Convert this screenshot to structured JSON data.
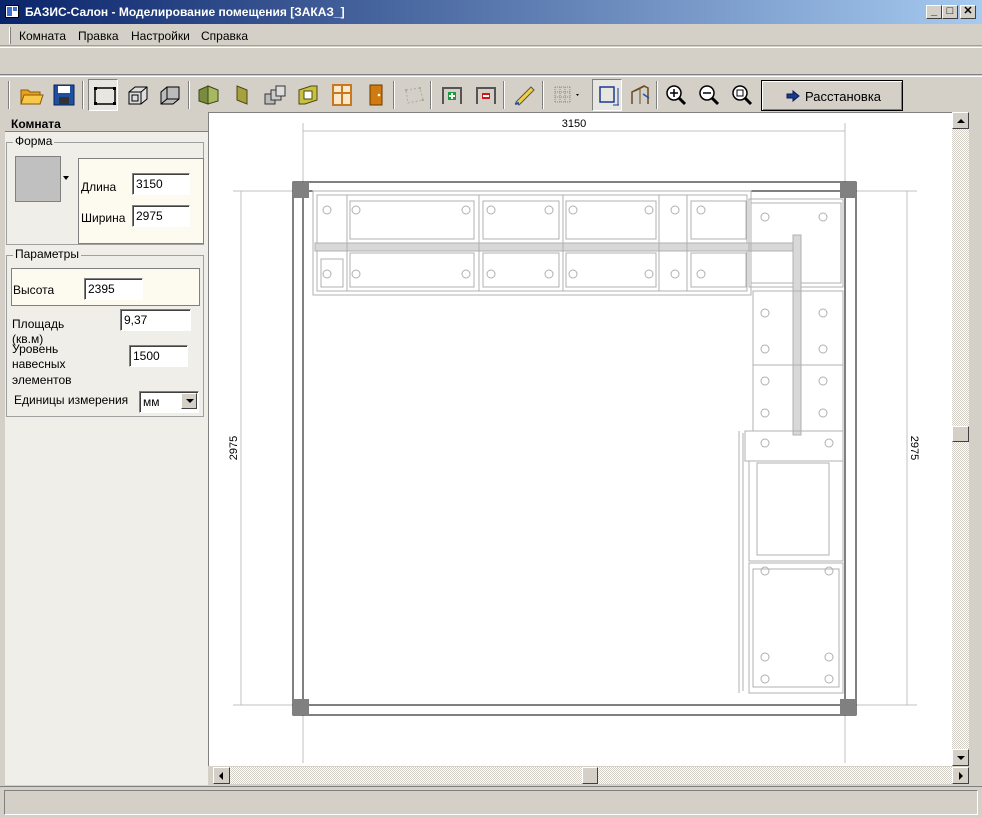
{
  "window": {
    "title": "БАЗИС-Салон - Моделирование помещения [ЗАКАЗ_]",
    "minimize_glyph": "_",
    "maximize_glyph": "□",
    "close_glyph": "✕"
  },
  "menu": {
    "items": [
      "Комната",
      "Правка",
      "Настройки",
      "Справка"
    ]
  },
  "toolbar": {
    "icons": [
      "open-folder-icon",
      "save-disk-icon",
      "room-outline-icon",
      "box-3d-icon",
      "box-3d-alt-icon",
      "wall-panels-icon",
      "wall-panel-icon",
      "cylinder-blocks-icon",
      "wall-niche-icon",
      "window-frame-icon",
      "door-icon",
      "polygon-room-icon",
      "add-wall-icon",
      "remove-wall-icon",
      "measure-icon",
      "grid-icon",
      "room-select-icon",
      "stairs-icon",
      "zoom-in-icon",
      "zoom-out-icon",
      "zoom-fit-icon"
    ],
    "arrange_label": "Расстановка"
  },
  "panel": {
    "header": "Комната",
    "shape_group": "Форма",
    "length_label": "Длина",
    "length_value": "3150",
    "width_label": "Ширина",
    "width_value": "2975",
    "params_group": "Параметры",
    "height_label": "Высота",
    "height_value": "2395",
    "area_label_1": "Площадь",
    "area_label_2": "(кв.м)",
    "area_value": "9,37",
    "level_label_1": "Уровень",
    "level_label_2": "навесных",
    "level_label_3": "элементов",
    "level_value": "1500",
    "units_label": "Единицы измерения",
    "units_value": "мм"
  },
  "plan": {
    "dim_top": "3150",
    "dim_left": "2975",
    "dim_right": "2975",
    "line_color": "#000000",
    "furniture_color": "#b0b0b0",
    "corner_color": "#808080"
  }
}
